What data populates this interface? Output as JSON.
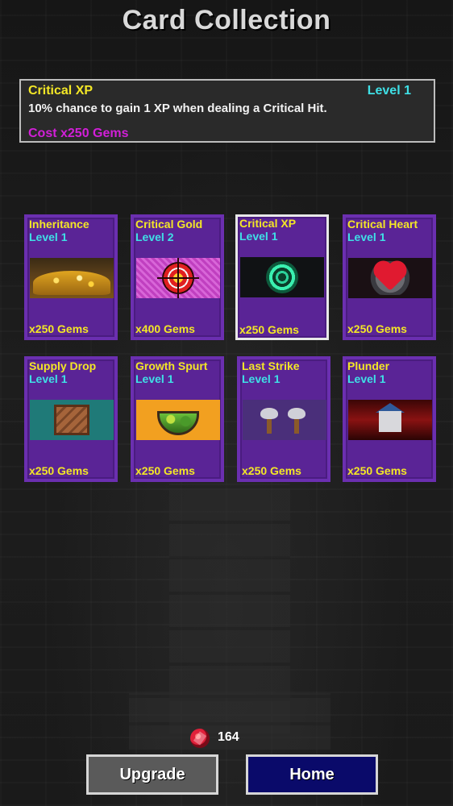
{
  "title": "Card Collection",
  "info": {
    "name": "Critical XP",
    "level": "Level 1",
    "description": "10% chance to gain 1 XP when dealing a Critical Hit.",
    "cost": "Cost x250 Gems"
  },
  "cards": [
    {
      "name": "Inheritance",
      "level": "Level 1",
      "cost": "x250 Gems",
      "icon": "treasure-pile-icon"
    },
    {
      "name": "Critical Gold",
      "level": "Level 2",
      "cost": "x400 Gems",
      "icon": "target-icon"
    },
    {
      "name": "Critical XP",
      "level": "Level 1",
      "cost": "x250 Gems",
      "icon": "xp-orb-icon",
      "selected": true
    },
    {
      "name": "Critical Heart",
      "level": "Level 1",
      "cost": "x250 Gems",
      "icon": "heart-icon"
    },
    {
      "name": "Supply Drop",
      "level": "Level 1",
      "cost": "x250 Gems",
      "icon": "crate-icon"
    },
    {
      "name": "Growth Spurt",
      "level": "Level 1",
      "cost": "x250 Gems",
      "icon": "soup-bowl-icon"
    },
    {
      "name": "Last Strike",
      "level": "Level 1",
      "cost": "x250 Gems",
      "icon": "axes-icon"
    },
    {
      "name": "Plunder",
      "level": "Level 1",
      "cost": "x250 Gems",
      "icon": "burning-house-icon"
    }
  ],
  "gems": {
    "count": "164",
    "icon": "gem-icon"
  },
  "buttons": {
    "upgrade": "Upgrade",
    "home": "Home"
  },
  "colors": {
    "card_bg": "#5a2496",
    "name_yellow": "#f3e726",
    "level_cyan": "#3fe0e6",
    "cost_magenta": "#d21fd8",
    "home_blue": "#0a0a6a"
  }
}
